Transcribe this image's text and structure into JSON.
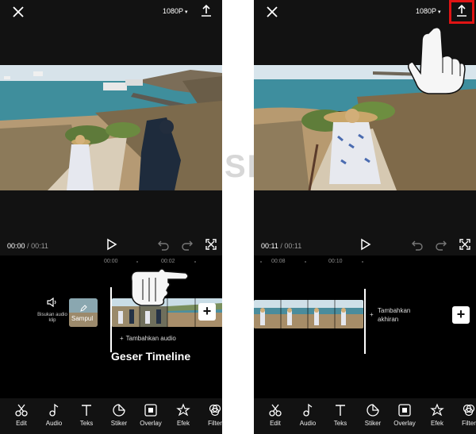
{
  "left": {
    "resolution": "1080P",
    "time_current": "00:00",
    "time_sep": "/",
    "time_total": "00:11",
    "ticks": [
      "00:00",
      "00:02"
    ],
    "audio_label": "Bisukan audio klip",
    "cover_label": "Sampul",
    "add_audio": "Tambahkan audio",
    "caption": "Geser Timeline"
  },
  "right": {
    "resolution": "1080P",
    "time_current": "00:11",
    "time_sep": "/",
    "time_total": "00:11",
    "ticks": [
      "00:08",
      "00:10"
    ],
    "add_ending_line1": "Tambahkan",
    "add_ending_line2": "akhiran"
  },
  "toolbar": [
    {
      "label": "Edit",
      "icon": "scissors-icon"
    },
    {
      "label": "Audio",
      "icon": "music-note-icon"
    },
    {
      "label": "Teks",
      "icon": "text-icon"
    },
    {
      "label": "Stiker",
      "icon": "sticker-icon"
    },
    {
      "label": "Overlay",
      "icon": "overlay-icon"
    },
    {
      "label": "Efek",
      "icon": "effects-icon"
    },
    {
      "label": "Filter",
      "icon": "filter-icon"
    }
  ],
  "watermark": "SPINTA",
  "colors": {
    "highlight": "#e01414",
    "background": "#121212",
    "timeline": "#000000"
  }
}
